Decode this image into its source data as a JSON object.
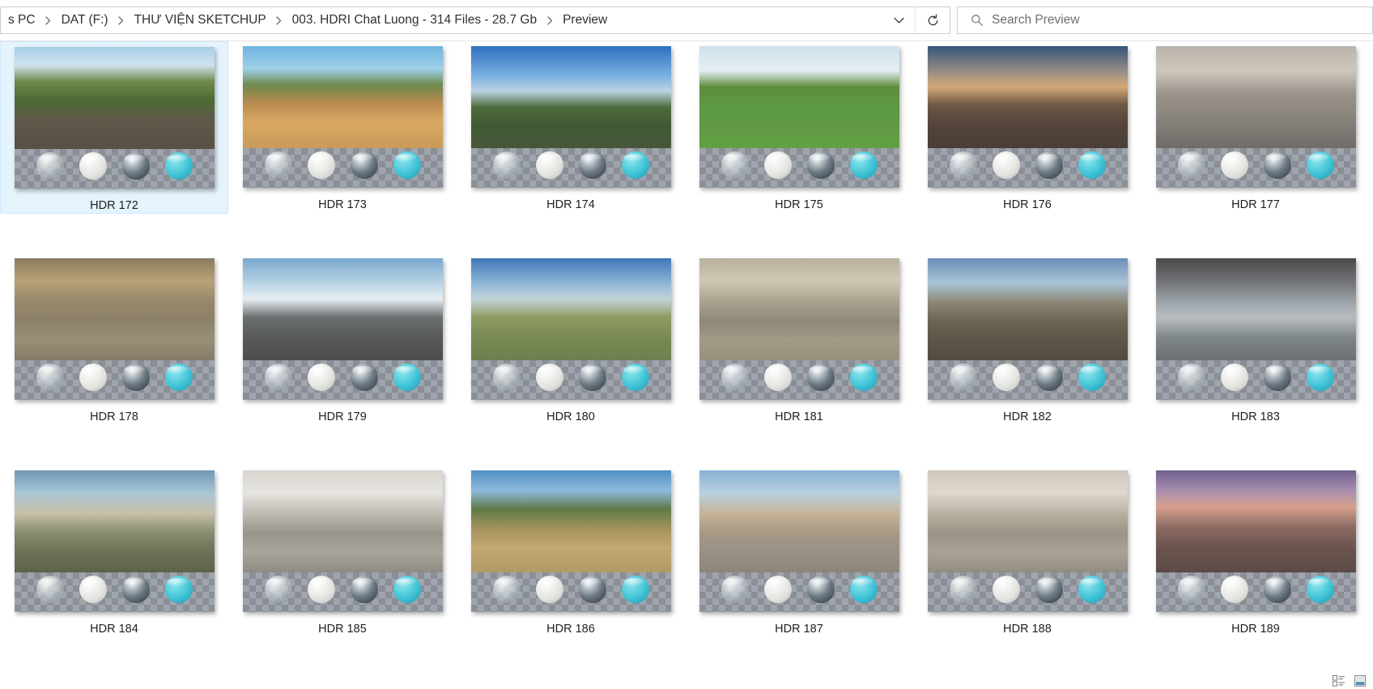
{
  "window": {
    "title": "Preview"
  },
  "addressbar": {
    "breadcrumbs": [
      {
        "label": "s PC"
      },
      {
        "label": "DAT  (F:)"
      },
      {
        "label": "THƯ VIỆN SKETCHUP"
      },
      {
        "label": "003. HDRI Chat Luong - 314 Files - 28.7 Gb"
      },
      {
        "label": "Preview"
      }
    ],
    "dropdown_icon": "chevron-down-icon",
    "refresh_icon": "refresh-icon",
    "search": {
      "icon": "search-icon",
      "placeholder": "Search Preview",
      "value": ""
    }
  },
  "grid": {
    "selected_index": 0,
    "rows": [
      [
        {
          "label": "HDR 172",
          "sky_css": "linear-gradient(180deg,#a9cfe6 0%,#cfe3ee 18%,#6e8a4a 34%,#4c6b33 52%,#5e5a4a 70%,#585044 100%)"
        },
        {
          "label": "HDR 173",
          "sky_css": "linear-gradient(180deg,#6eb4e0 0%,#9fd0e8 22%,#6d8a4e 38%,#b98a4e 56%,#d9a964 74%,#c99a58 100%)"
        },
        {
          "label": "HDR 174",
          "sky_css": "linear-gradient(180deg,#2f6fc0 0%,#76aee0 28%,#bcd3e4 44%,#4e6b3c 60%,#3f5a33 78%,#48563a 100%)"
        },
        {
          "label": "HDR 175",
          "sky_css": "linear-gradient(180deg,#cfe0ea 0%,#e4eef3 24%,#5f8d3e 40%,#5d9940 60%,#5f9a42 80%,#63a045 100%)"
        },
        {
          "label": "HDR 176",
          "sky_css": "linear-gradient(180deg,#35557a 0%,#9c8f84 26%,#d4a878 40%,#6b5743 58%,#53443a 78%,#4a3e36 100%)"
        },
        {
          "label": "HDR 177",
          "sky_css": "linear-gradient(180deg,#b9b3ab 0%,#cdc7bd 24%,#9a948c 46%,#8e8880 64%,#7e7a74 82%,#6f6c68 100%)"
        }
      ],
      [
        {
          "label": "HDR 178",
          "sky_css": "linear-gradient(180deg,#8a7a5e 0%,#b8a279 22%,#95886a 42%,#8c8068 60%,#9a8f76 80%,#857a66 100%)"
        },
        {
          "label": "HDR 179",
          "sky_css": "linear-gradient(180deg,#7aa8cf 0%,#bdd6e6 26%,#e7eef3 40%,#6c6f70 58%,#57595b 78%,#4c4e50 100%)"
        },
        {
          "label": "HDR 180",
          "sky_css": "linear-gradient(180deg,#3f76b8 0%,#8cb6d8 24%,#c3d3d8 40%,#8e9b63 58%,#7a8a55 76%,#6e7f4e 100%)"
        },
        {
          "label": "HDR 181",
          "sky_css": "linear-gradient(180deg,#b9b29f 0%,#cfc8b4 22%,#a79f8c 44%,#8f8878 62%,#a39b88 80%,#99917e 100%)"
        },
        {
          "label": "HDR 182",
          "sky_css": "linear-gradient(180deg,#6b8fb8 0%,#a9c3d6 24%,#8b8574 44%,#6b6354 62%,#5c5648 80%,#514c40 100%)"
        },
        {
          "label": "HDR 183",
          "sky_css": "linear-gradient(180deg,#4a4a4c 0%,#6f7174 22%,#9aa2a8 42%,#b7bdc1 58%,#7e8589 78%,#6a7074 100%)"
        }
      ],
      [
        {
          "label": "HDR 184",
          "sky_css": "linear-gradient(180deg,#6f97b4 0%,#a9c6d6 22%,#c8c0a8 42%,#8a8f72 60%,#6e7458 78%,#5d6349 100%)"
        },
        {
          "label": "HDR 185",
          "sky_css": "linear-gradient(180deg,#d8d6cf 0%,#e6e4de 22%,#bab7ae 44%,#97948c 62%,#a8a59c 80%,#8e8b83 100%)"
        },
        {
          "label": "HDR 186",
          "sky_css": "linear-gradient(180deg,#4f8fc4 0%,#8fbadc 20%,#5f7a46 38%,#a8935f 58%,#c2a873 76%,#b29a66 100%)"
        },
        {
          "label": "HDR 187",
          "sky_css": "linear-gradient(180deg,#88b2d4 0%,#b7d0e2 22%,#c6b49a 42%,#a89a84 60%,#9a9186 78%,#8d857a 100%)"
        },
        {
          "label": "HDR 188",
          "sky_css": "linear-gradient(180deg,#cfc8bd 0%,#ded8cd 22%,#b5ae9f 44%,#9b9486 62%,#aaa296 80%,#938c80 100%)"
        },
        {
          "label": "HDR 189",
          "sky_css": "linear-gradient(180deg,#6e5f8e 0%,#a98fae 20%,#d6a08c 36%,#8a6b63 56%,#6b544f 76%,#5c4a46 100%)"
        }
      ]
    ],
    "sphere_kinds": [
      "glass",
      "white",
      "chrome",
      "teal"
    ]
  },
  "statusbar": {
    "view_buttons": [
      {
        "icon": "details-view-icon",
        "label": "Details view"
      },
      {
        "icon": "large-icons-view-icon",
        "label": "Large icons view"
      }
    ]
  }
}
